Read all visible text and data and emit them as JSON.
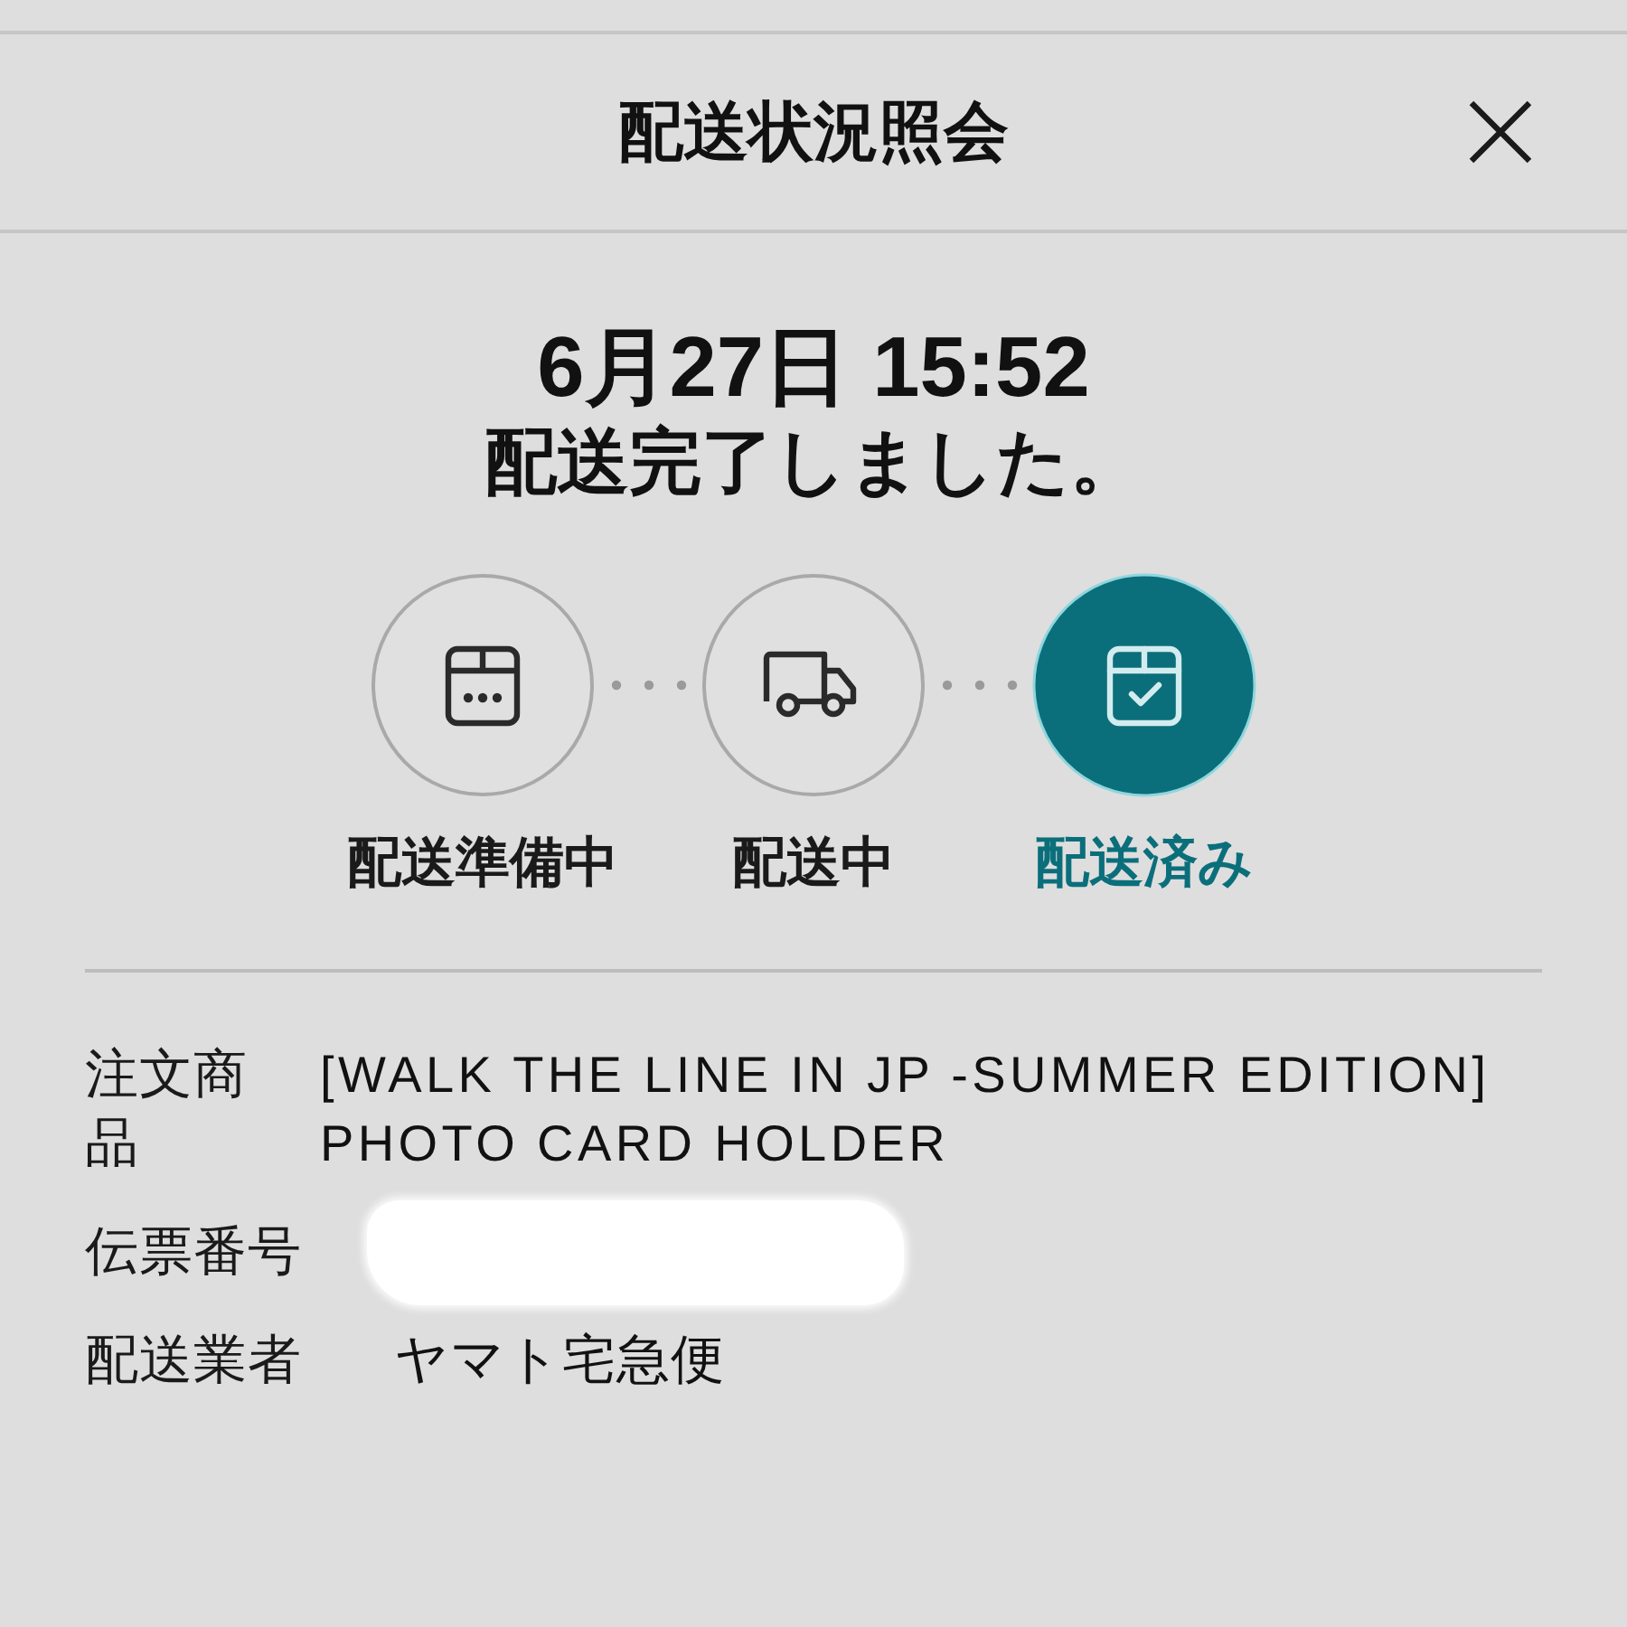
{
  "header": {
    "title": "配送状況照会"
  },
  "status": {
    "datetime": "6月27日 15:52",
    "message": "配送完了しました。"
  },
  "steps": [
    {
      "kind": "preparing",
      "label": "配送準備中",
      "selected": false
    },
    {
      "kind": "shipping",
      "label": "配送中",
      "selected": false
    },
    {
      "kind": "delivered",
      "label": "配送済み",
      "selected": true
    }
  ],
  "details": [
    {
      "label": "注文商品",
      "value": "[WALK THE LINE IN JP -SUMMER EDITION] PHOTO CARD HOLDER",
      "redacted": false
    },
    {
      "label": "伝票番号",
      "redacted": true
    },
    {
      "label": "配送業者",
      "value": "ヤマト宅急便",
      "redacted": false
    }
  ]
}
